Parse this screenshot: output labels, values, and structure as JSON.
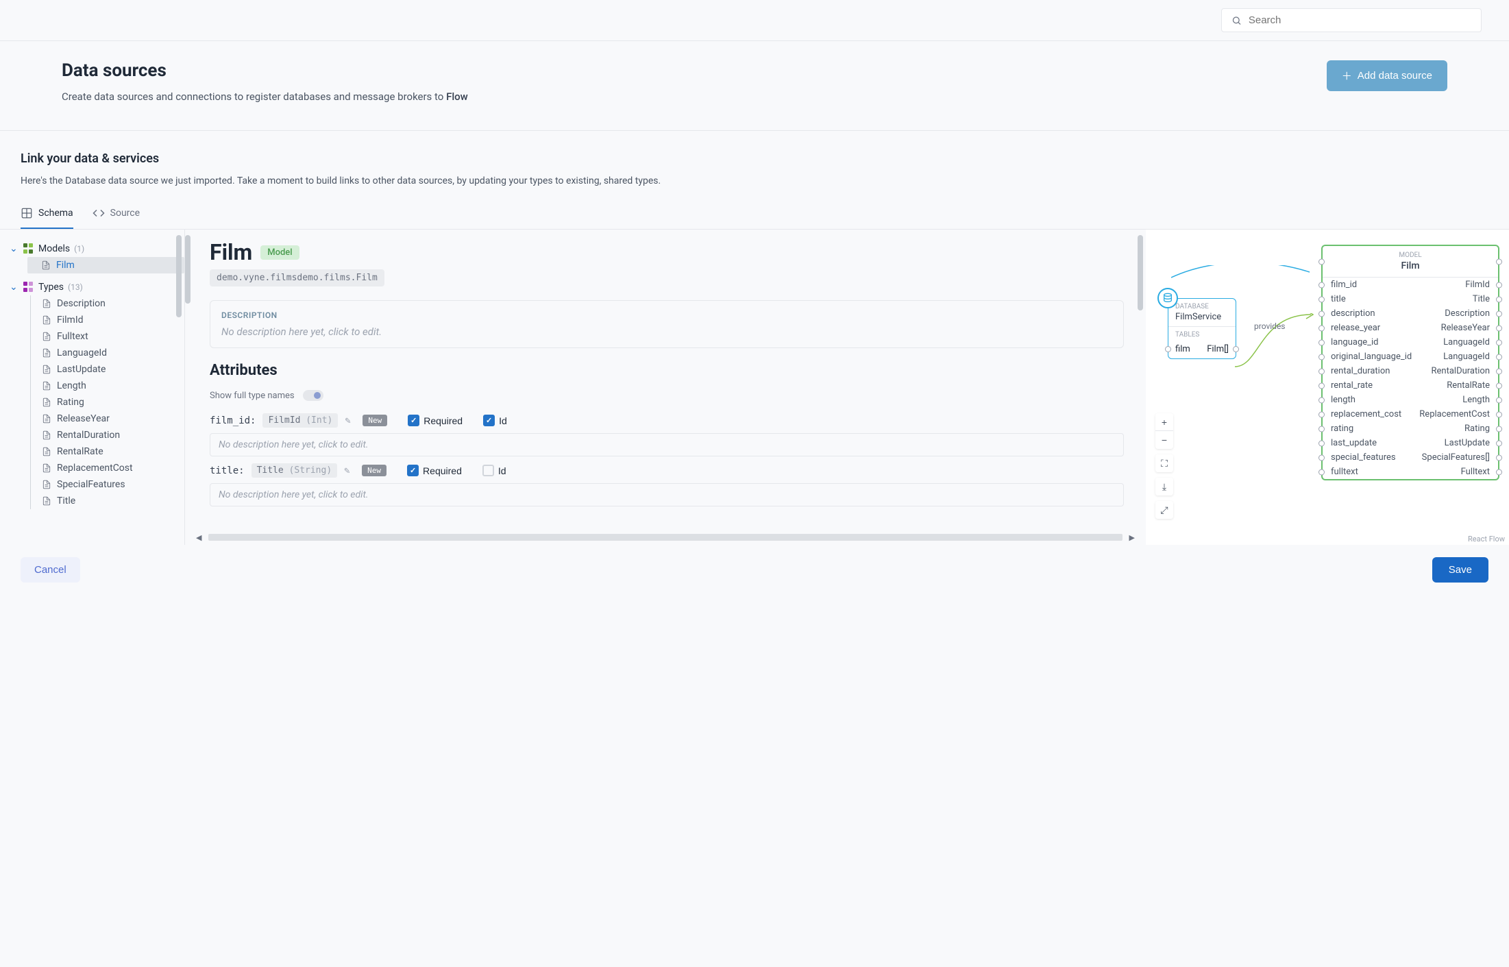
{
  "search": {
    "placeholder": "Search"
  },
  "header": {
    "title": "Data sources",
    "subtitle_prefix": "Create data sources and connections to register databases and message brokers to ",
    "subtitle_highlight": "Flow",
    "add_button": "Add data source"
  },
  "section": {
    "title": "Link your data & services",
    "body": "Here's the Database data source we just imported. Take a moment to build links to other data sources, by updating your types to existing, shared types."
  },
  "tabs": {
    "schema": "Schema",
    "source": "Source"
  },
  "tree": {
    "models": {
      "label": "Models",
      "count": "(1)",
      "items": [
        "Film"
      ]
    },
    "types": {
      "label": "Types",
      "count": "(13)",
      "items": [
        "Description",
        "FilmId",
        "Fulltext",
        "LanguageId",
        "LastUpdate",
        "Length",
        "Rating",
        "ReleaseYear",
        "RentalDuration",
        "RentalRate",
        "ReplacementCost",
        "SpecialFeatures",
        "Title"
      ]
    }
  },
  "detail": {
    "title": "Film",
    "badge": "Model",
    "qualified": "demo.vyne.filmsdemo.films.Film",
    "description_label": "DESCRIPTION",
    "description_placeholder": "No description here yet, click to edit.",
    "attributes_title": "Attributes",
    "toggle_label": "Show full type names",
    "new_badge": "New",
    "required_label": "Required",
    "id_label": "Id",
    "attr_desc_placeholder": "No description here yet, click to edit.",
    "attrs": [
      {
        "name": "film_id:",
        "type": "FilmId",
        "ptype": "(Int)",
        "required": true,
        "id": true
      },
      {
        "name": "title:",
        "type": "Title",
        "ptype": "(String)",
        "required": true,
        "id": false
      }
    ]
  },
  "diagram": {
    "db": {
      "label": "DATABASE",
      "name": "FilmService",
      "tables_label": "TABLES",
      "table": "film",
      "table_type": "Film[]"
    },
    "provides": "provides",
    "model": {
      "label": "MODEL",
      "name": "Film",
      "attrs": [
        {
          "col": "film_id",
          "type": "FilmId"
        },
        {
          "col": "title",
          "type": "Title"
        },
        {
          "col": "description",
          "type": "Description"
        },
        {
          "col": "release_year",
          "type": "ReleaseYear"
        },
        {
          "col": "language_id",
          "type": "LanguageId"
        },
        {
          "col": "original_language_id",
          "type": "LanguageId"
        },
        {
          "col": "rental_duration",
          "type": "RentalDuration"
        },
        {
          "col": "rental_rate",
          "type": "RentalRate"
        },
        {
          "col": "length",
          "type": "Length"
        },
        {
          "col": "replacement_cost",
          "type": "ReplacementCost"
        },
        {
          "col": "rating",
          "type": "Rating"
        },
        {
          "col": "last_update",
          "type": "LastUpdate"
        },
        {
          "col": "special_features",
          "type": "SpecialFeatures[]"
        },
        {
          "col": "fulltext",
          "type": "Fulltext"
        }
      ]
    },
    "attribution": "React Flow"
  },
  "footer": {
    "cancel": "Cancel",
    "save": "Save"
  }
}
